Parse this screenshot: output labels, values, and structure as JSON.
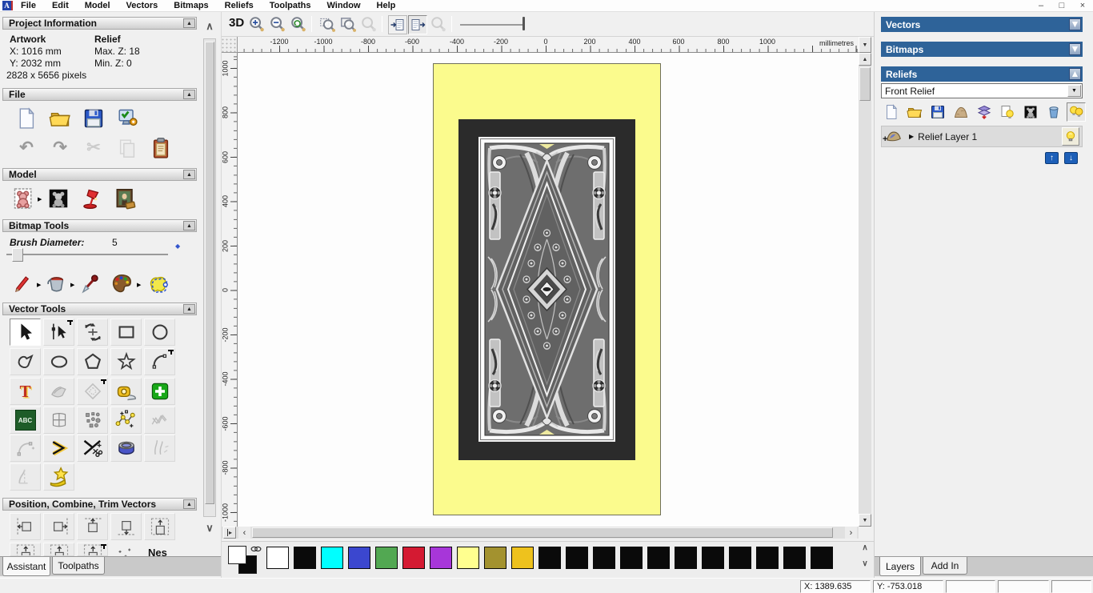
{
  "glyphs": {
    "app_icon": "A",
    "minimize": "–",
    "restore": "□",
    "close": "×",
    "collapse": "▲",
    "expand": "▼",
    "undo": "↶",
    "redo": "↷",
    "cut": "✂",
    "flyout": "▶",
    "chev_up": "∧",
    "chev_down": "∨",
    "sb_up": "▲",
    "sb_down": "▼",
    "sb_left": "‹",
    "sb_right": "›",
    "sb_first": "▸",
    "arr_up": "↑",
    "arr_down": "↓",
    "plus": "+",
    "diamond": "◆",
    "tee": "T",
    "abc": "ABC",
    "layer_expand": "▶"
  },
  "menu": {
    "items": [
      "File",
      "Edit",
      "Model",
      "Vectors",
      "Bitmaps",
      "Reliefs",
      "Toolpaths",
      "Window",
      "Help"
    ]
  },
  "assistant": {
    "project": {
      "title": "Project Information",
      "artwork_heading": "Artwork",
      "relief_heading": "Relief",
      "x": "X: 1016 mm",
      "y": "Y: 2032 mm",
      "pixels": "2828 x 5656 pixels",
      "max_z": "Max. Z: 18",
      "min_z": "Min. Z: 0"
    },
    "file_title": "File",
    "model_title": "Model",
    "bitmap_title": "Bitmap Tools",
    "brush_label": "Brush Diameter:",
    "brush_value": "5",
    "vector_title": "Vector Tools",
    "position_title": "Position, Combine, Trim Vectors",
    "nesting_label": "Nes",
    "tab_assistant": "Assistant",
    "tab_toolpaths": "Toolpaths"
  },
  "canvas": {
    "btn_3d": "3D",
    "ruler_unit": "millimetres",
    "h_ruler": [
      "-1200",
      "-1000",
      "-800",
      "-600",
      "-400",
      "-200",
      "0",
      "200",
      "400",
      "600",
      "800",
      "1000"
    ],
    "v_ruler": [
      "1000",
      "800",
      "600",
      "400",
      "200",
      "0",
      "-200",
      "-400",
      "-600",
      "-800",
      "-1000"
    ]
  },
  "artwork": {
    "canvas_color": "#fbfb8d",
    "mat_color": "#2b2b2b"
  },
  "palette": {
    "primary": "#ffffff",
    "secondary": "#0a0a0a",
    "colors": [
      "#ffffff",
      "#0a0a0a",
      "#00ffff",
      "#3b47cf",
      "#52a852",
      "#d41a32",
      "#a736d9",
      "#ffff8f",
      "#a3922f",
      "#eec21d",
      "#0a0a0a",
      "#0a0a0a",
      "#0a0a0a",
      "#0a0a0a",
      "#0a0a0a",
      "#0a0a0a",
      "#0a0a0a",
      "#0a0a0a",
      "#0a0a0a",
      "#0a0a0a",
      "#0a0a0a"
    ]
  },
  "theme": {
    "panel_header_blue": "#2e6399"
  },
  "right": {
    "vectors_title": "Vectors",
    "bitmaps_title": "Bitmaps",
    "reliefs_title": "Reliefs",
    "relief_dropdown": "Front Relief",
    "layer_name": "Relief Layer 1",
    "tab_layers": "Layers",
    "tab_addin": "Add In"
  },
  "status": {
    "x": "X: 1389.635",
    "y": "Y: -753.018"
  }
}
